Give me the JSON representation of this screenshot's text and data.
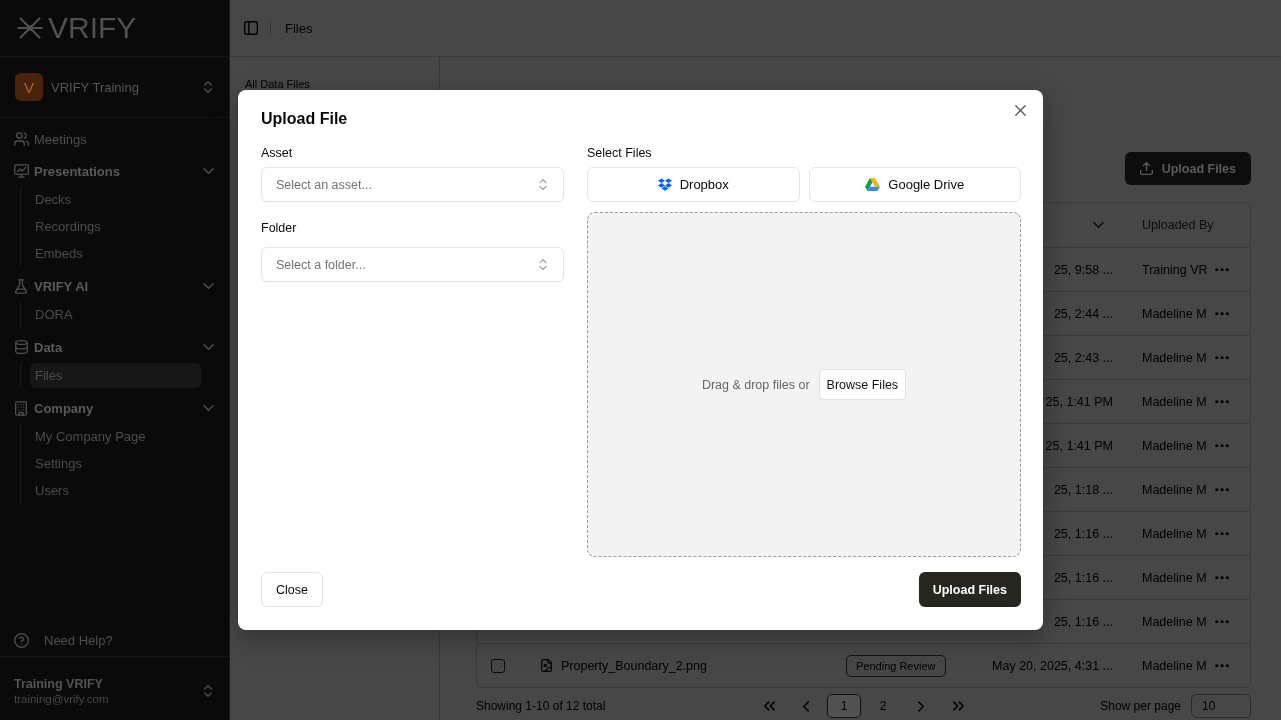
{
  "sidebar": {
    "logo": "VRIFY",
    "workspace": {
      "initial": "V",
      "name": "VRIFY Training"
    },
    "nav": [
      {
        "kind": "link",
        "label": "Meetings",
        "selected": false
      },
      {
        "kind": "group",
        "label": "Presentations",
        "selected": false,
        "expanded": true,
        "children": [
          {
            "label": "Decks",
            "selected": false
          },
          {
            "label": "Recordings",
            "selected": false
          },
          {
            "label": "Embeds",
            "selected": false
          }
        ]
      },
      {
        "kind": "group",
        "label": "VRIFY AI",
        "selected": false,
        "expanded": true,
        "children": [
          {
            "label": "DORA",
            "selected": false
          }
        ]
      },
      {
        "kind": "group",
        "label": "Data",
        "selected": false,
        "expanded": true,
        "children": [
          {
            "label": "Files",
            "selected": true
          }
        ]
      },
      {
        "kind": "group",
        "label": "Company",
        "selected": false,
        "expanded": true,
        "children": [
          {
            "label": "My Company Page",
            "selected": false
          },
          {
            "label": "Settings",
            "selected": false
          },
          {
            "label": "Users",
            "selected": false
          }
        ]
      }
    ],
    "help": "Need Help?",
    "user": {
      "name": "Training VRIFY",
      "email": "training@vrify.com"
    }
  },
  "topbar": {
    "breadcrumb": "Files"
  },
  "folders": {
    "title": "All Data Files"
  },
  "files": {
    "upload_button": "Upload Files",
    "table": {
      "header": {
        "uploaded_by": "Uploaded By"
      },
      "rows": [
        {
          "date": "25, 9:58 ...",
          "uploaded_by": "Training VR"
        },
        {
          "date": "25, 2:44 ...",
          "uploaded_by": "Madeline M"
        },
        {
          "date": "25, 2:43 ...",
          "uploaded_by": "Madeline M"
        },
        {
          "date": "25, 1:41 PM",
          "uploaded_by": "Madeline M"
        },
        {
          "date": "25, 1:41 PM",
          "uploaded_by": "Madeline M"
        },
        {
          "date": "25, 1:18 ...",
          "uploaded_by": "Madeline M"
        },
        {
          "date": "25, 1:16 ...",
          "uploaded_by": "Madeline M"
        },
        {
          "date": "25, 1:16 ...",
          "uploaded_by": "Madeline M"
        },
        {
          "date": "25, 1:16 ...",
          "uploaded_by": "Madeline M"
        },
        {
          "checked": false,
          "name": "Property_Boundary_2.png",
          "status": "Pending Review",
          "date": "May 20, 2025, 4:31 ...",
          "uploaded_by": "Madeline M"
        }
      ]
    },
    "footer": {
      "summary": "Showing 1-10 of 12 total",
      "pages": [
        {
          "label": "1",
          "selected": true
        },
        {
          "label": "2",
          "selected": false
        }
      ],
      "per_page_label": "Show per page",
      "per_page": "10"
    }
  },
  "dialog": {
    "title": "Upload File",
    "asset": {
      "label": "Asset",
      "placeholder": "Select an asset..."
    },
    "folder": {
      "label": "Folder",
      "placeholder": "Select a folder..."
    },
    "select_files": {
      "label": "Select Files",
      "sources": [
        {
          "label": "Dropbox"
        },
        {
          "label": "Google Drive"
        }
      ],
      "dropzone": {
        "text": "Drag & drop files or",
        "button": "Browse Files"
      }
    },
    "buttons": [
      {
        "kind": "secondary",
        "label": "Close"
      },
      {
        "kind": "primary",
        "label": "Upload Files"
      }
    ]
  }
}
